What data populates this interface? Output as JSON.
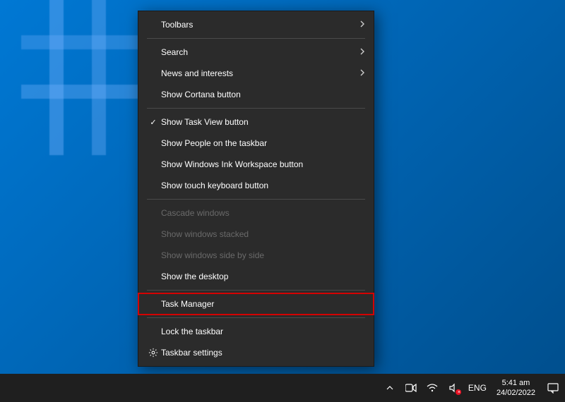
{
  "context_menu": {
    "items": [
      {
        "label": "Toolbars",
        "submenu": true,
        "checked": false,
        "disabled": false,
        "icon": null
      },
      {
        "sep": true
      },
      {
        "label": "Search",
        "submenu": true,
        "checked": false,
        "disabled": false,
        "icon": null
      },
      {
        "label": "News and interests",
        "submenu": true,
        "checked": false,
        "disabled": false,
        "icon": null
      },
      {
        "label": "Show Cortana button",
        "submenu": false,
        "checked": false,
        "disabled": false,
        "icon": null
      },
      {
        "sep": true
      },
      {
        "label": "Show Task View button",
        "submenu": false,
        "checked": true,
        "disabled": false,
        "icon": null
      },
      {
        "label": "Show People on the taskbar",
        "submenu": false,
        "checked": false,
        "disabled": false,
        "icon": null
      },
      {
        "label": "Show Windows Ink Workspace button",
        "submenu": false,
        "checked": false,
        "disabled": false,
        "icon": null
      },
      {
        "label": "Show touch keyboard button",
        "submenu": false,
        "checked": false,
        "disabled": false,
        "icon": null
      },
      {
        "sep": true
      },
      {
        "label": "Cascade windows",
        "submenu": false,
        "checked": false,
        "disabled": true,
        "icon": null
      },
      {
        "label": "Show windows stacked",
        "submenu": false,
        "checked": false,
        "disabled": true,
        "icon": null
      },
      {
        "label": "Show windows side by side",
        "submenu": false,
        "checked": false,
        "disabled": true,
        "icon": null
      },
      {
        "label": "Show the desktop",
        "submenu": false,
        "checked": false,
        "disabled": false,
        "icon": null
      },
      {
        "sep": true
      },
      {
        "label": "Task Manager",
        "submenu": false,
        "checked": false,
        "disabled": false,
        "icon": null,
        "highlighted": true
      },
      {
        "sep": true
      },
      {
        "label": "Lock the taskbar",
        "submenu": false,
        "checked": false,
        "disabled": false,
        "icon": null
      },
      {
        "label": "Taskbar settings",
        "submenu": false,
        "checked": false,
        "disabled": false,
        "icon": "gear"
      }
    ]
  },
  "taskbar": {
    "language": "ENG",
    "time": "5:41 am",
    "date": "24/02/2022"
  }
}
